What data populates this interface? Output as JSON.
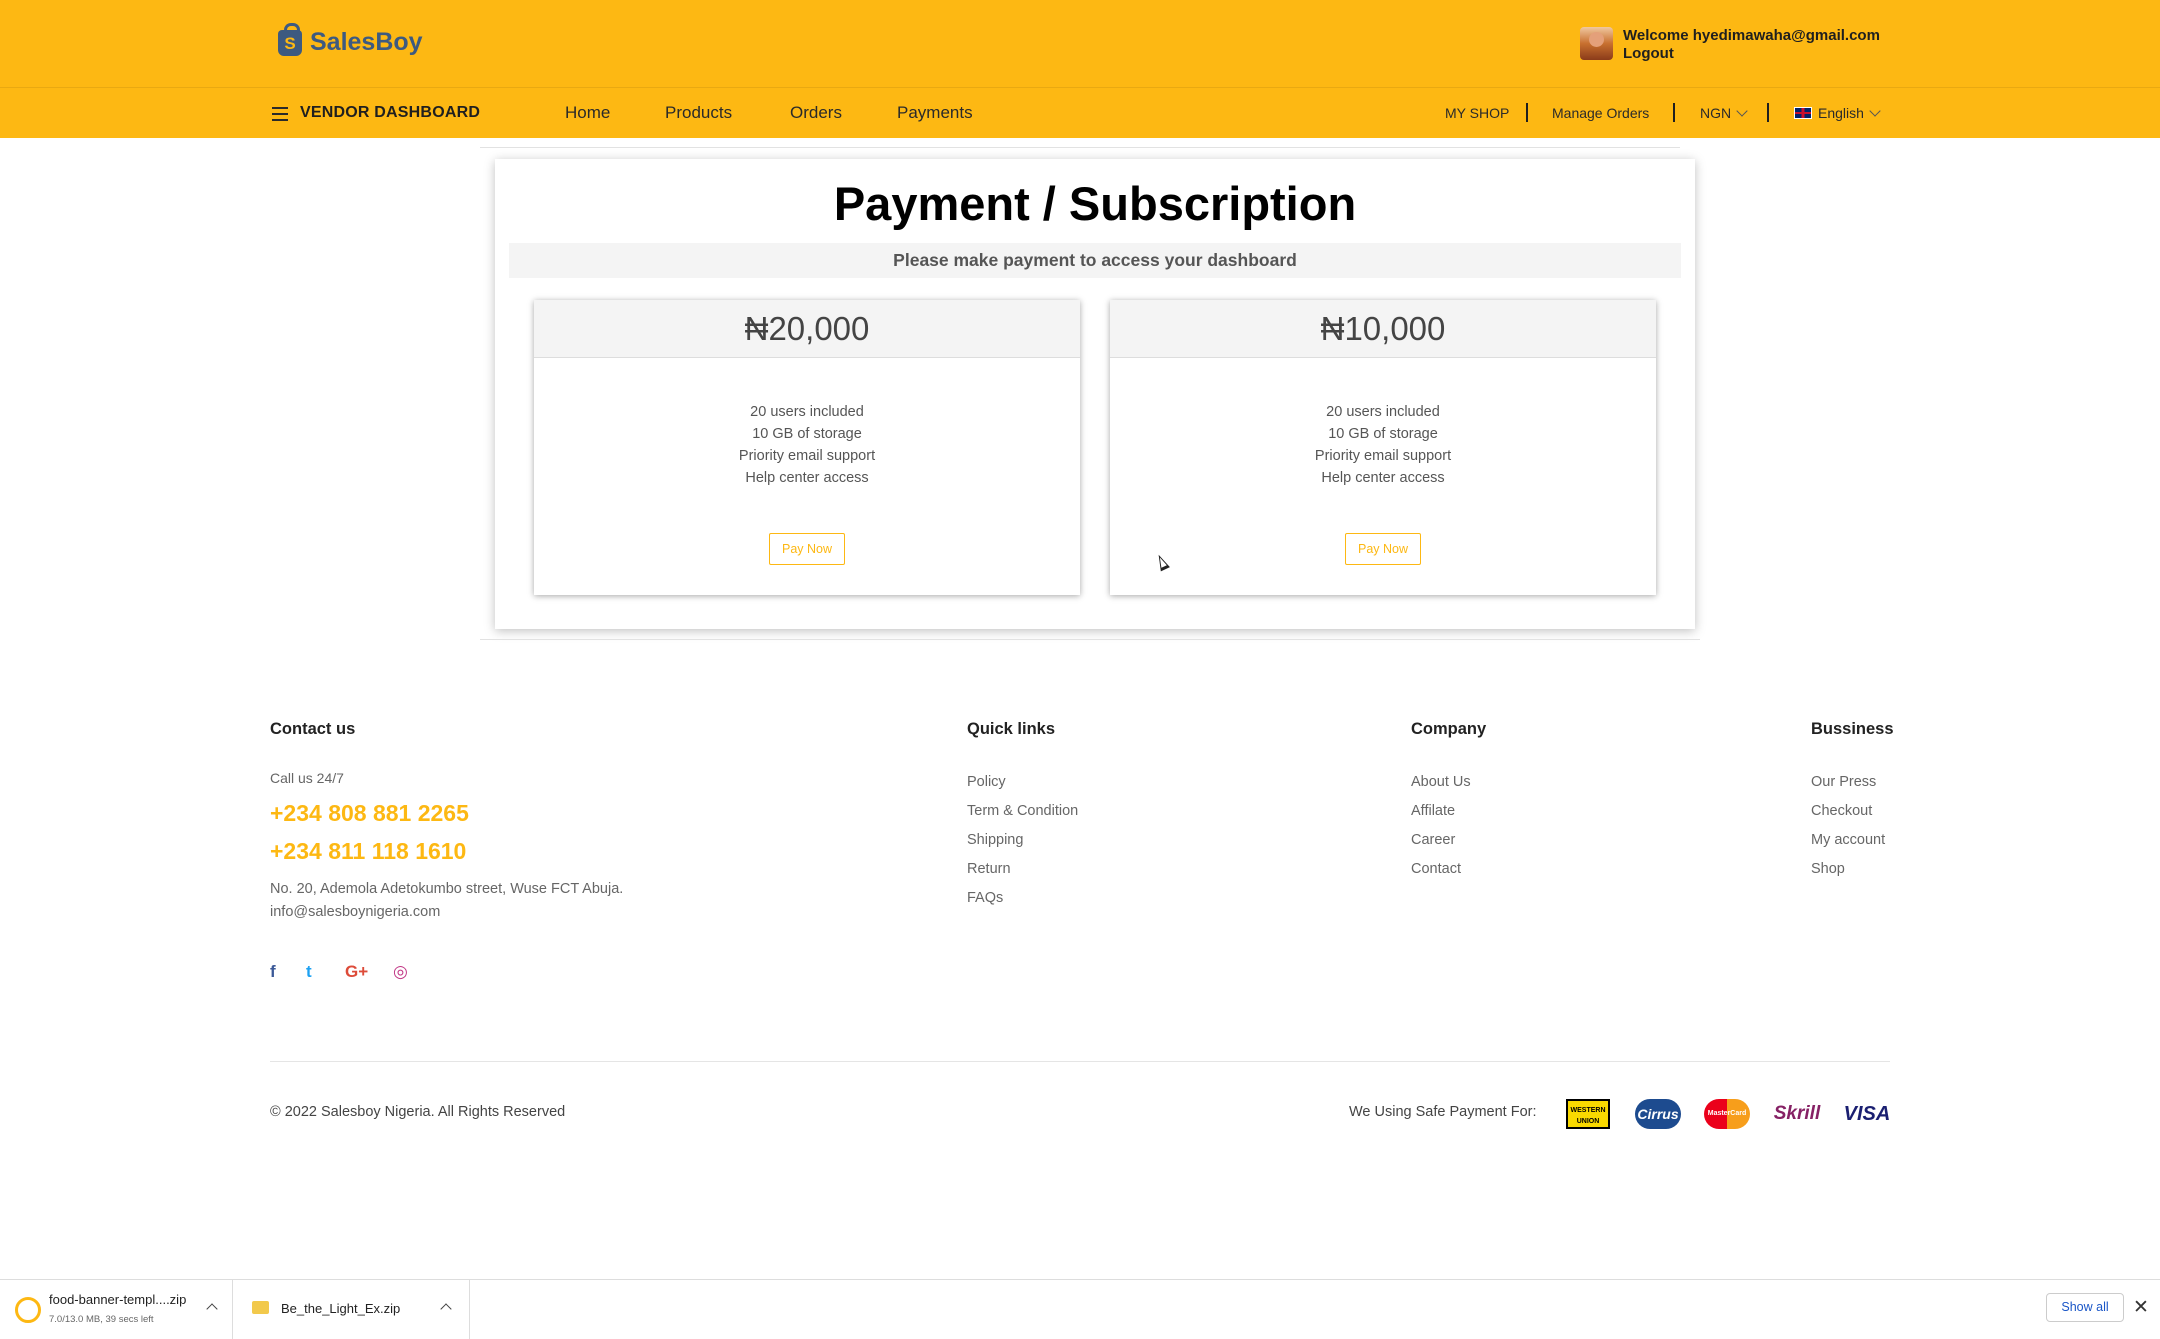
{
  "header": {
    "logo_letter": "S",
    "brand": "SalesBoy",
    "welcome": "Welcome hyedimawaha@gmail.com",
    "logout": "Logout"
  },
  "navbar": {
    "vendor_label": "VENDOR DASHBOARD",
    "links": [
      "Home",
      "Products",
      "Orders",
      "Payments"
    ],
    "my_shop": "MY SHOP",
    "manage_orders": "Manage Orders",
    "currency": "NGN",
    "language": "English"
  },
  "payment": {
    "title": "Payment / Subscription",
    "subtitle": "Please make payment to access your dashboard",
    "plans": [
      {
        "price": "₦20,000",
        "features": [
          "20 users included",
          "10 GB of storage",
          "Priority email support",
          "Help center access"
        ],
        "button": "Pay Now"
      },
      {
        "price": "₦10,000",
        "features": [
          "20 users included",
          "10 GB of storage",
          "Priority email support",
          "Help center access"
        ],
        "button": "Pay Now"
      }
    ]
  },
  "footer": {
    "contact": {
      "heading": "Contact us",
      "call_label": "Call us 24/7",
      "phones": [
        "+234 808 881 2265",
        "+234 811 118 1610"
      ],
      "address": "No. 20, Ademola Adetokumbo street, Wuse FCT Abuja.",
      "email": "info@salesboynigeria.com"
    },
    "quick_links": {
      "heading": "Quick links",
      "items": [
        "Policy",
        "Term & Condition",
        "Shipping",
        "Return",
        "FAQs"
      ]
    },
    "company": {
      "heading": "Company",
      "items": [
        "About Us",
        "Affilate",
        "Career",
        "Contact"
      ]
    },
    "business": {
      "heading": "Bussiness",
      "items": [
        "Our Press",
        "Checkout",
        "My account",
        "Shop"
      ]
    },
    "social": [
      {
        "icon": "facebook-icon",
        "glyph": "f",
        "color": "#3b5998"
      },
      {
        "icon": "twitter-icon",
        "glyph": "t",
        "color": "#1da1f2"
      },
      {
        "icon": "google-plus-icon",
        "glyph": "G+",
        "color": "#dd4b39"
      },
      {
        "icon": "instagram-icon",
        "glyph": "◎",
        "color": "#c13584"
      }
    ],
    "copyright": "© 2022 Salesboy Nigeria. All Rights Reserved",
    "safe_payment": "We Using Safe Payment For:",
    "payment_methods": [
      "WESTERN UNION",
      "Cirrus",
      "MasterCard",
      "Skrill",
      "VISA"
    ]
  },
  "downloads": {
    "items": [
      {
        "name": "food-banner-templ....zip",
        "meta": "7.0/13.0 MB, 39 secs left"
      },
      {
        "name": "Be_the_Light_Ex.zip",
        "meta": ""
      }
    ],
    "show_all": "Show all",
    "close": "✕"
  },
  "colors": {
    "accent": "#FDB813",
    "brand": "#3d5a80"
  }
}
